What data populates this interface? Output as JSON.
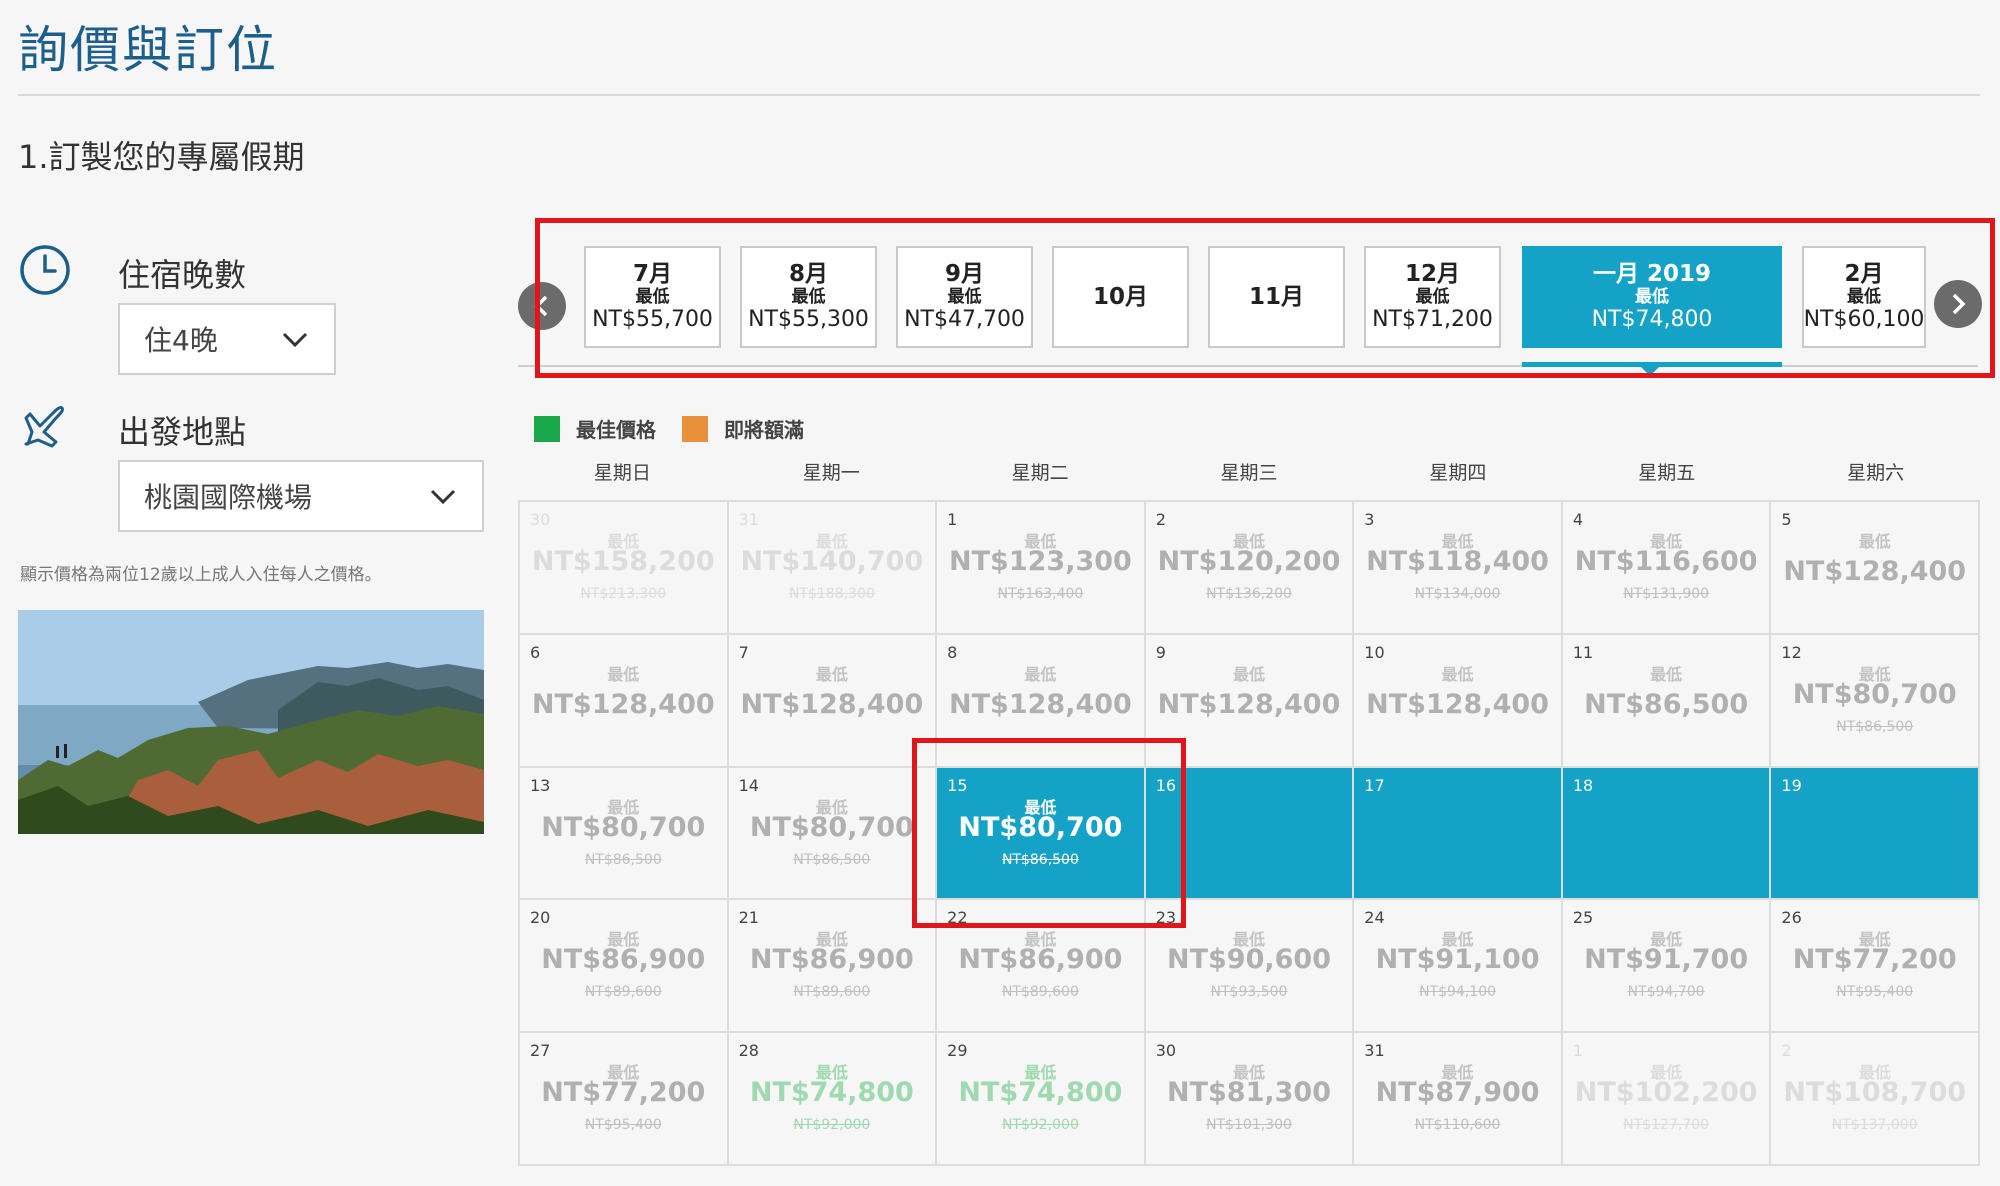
{
  "title": "詢價與訂位",
  "section_title": "1.訂製您的專屬假期",
  "stay": {
    "label": "住宿晚數",
    "value": "住4晚"
  },
  "departure": {
    "label": "出發地點",
    "value": "桃園國際機場"
  },
  "note": "顯示價格為兩位12歲以上成人入住每人之價格。",
  "months": [
    {
      "name": "7月",
      "low_label": "最低",
      "price": "NT$55,700"
    },
    {
      "name": "8月",
      "low_label": "最低",
      "price": "NT$55,300"
    },
    {
      "name": "9月",
      "low_label": "最低",
      "price": "NT$47,700"
    },
    {
      "name": "10月",
      "low_label": "",
      "price": ""
    },
    {
      "name": "11月",
      "low_label": "",
      "price": ""
    },
    {
      "name": "12月",
      "low_label": "最低",
      "price": "NT$71,200"
    },
    {
      "name": "一月 2019",
      "low_label": "最低",
      "price": "NT$74,800",
      "active": true
    },
    {
      "name": "2月",
      "low_label": "最低",
      "price": "NT$60,100"
    }
  ],
  "legend": [
    {
      "label": "最佳價格",
      "color": "#1aa84a"
    },
    {
      "label": "即將額滿",
      "color": "#e8913a"
    }
  ],
  "weekdays": [
    "星期日",
    "星期一",
    "星期二",
    "星期三",
    "星期四",
    "星期五",
    "星期六"
  ],
  "calendar": [
    {
      "day": "30",
      "low": "最低",
      "price": "NT$158,200",
      "old": "NT$213,300",
      "state": "other"
    },
    {
      "day": "31",
      "low": "最低",
      "price": "NT$140,700",
      "old": "NT$188,300",
      "state": "other"
    },
    {
      "day": "1",
      "low": "最低",
      "price": "NT$123,300",
      "old": "NT$163,400",
      "state": ""
    },
    {
      "day": "2",
      "low": "最低",
      "price": "NT$120,200",
      "old": "NT$136,200",
      "state": ""
    },
    {
      "day": "3",
      "low": "最低",
      "price": "NT$118,400",
      "old": "NT$134,000",
      "state": ""
    },
    {
      "day": "4",
      "low": "最低",
      "price": "NT$116,600",
      "old": "NT$131,900",
      "state": ""
    },
    {
      "day": "5",
      "low": "最低",
      "price": "NT$128,400",
      "old": "",
      "state": "noold"
    },
    {
      "day": "6",
      "low": "最低",
      "price": "NT$128,400",
      "old": "",
      "state": "noold"
    },
    {
      "day": "7",
      "low": "最低",
      "price": "NT$128,400",
      "old": "",
      "state": "noold"
    },
    {
      "day": "8",
      "low": "最低",
      "price": "NT$128,400",
      "old": "",
      "state": "noold"
    },
    {
      "day": "9",
      "low": "最低",
      "price": "NT$128,400",
      "old": "",
      "state": "noold"
    },
    {
      "day": "10",
      "low": "最低",
      "price": "NT$128,400",
      "old": "",
      "state": "noold"
    },
    {
      "day": "11",
      "low": "最低",
      "price": "NT$86,500",
      "old": "",
      "state": "noold"
    },
    {
      "day": "12",
      "low": "最低",
      "price": "NT$80,700",
      "old": "NT$86,500",
      "state": ""
    },
    {
      "day": "13",
      "low": "最低",
      "price": "NT$80,700",
      "old": "NT$86,500",
      "state": ""
    },
    {
      "day": "14",
      "low": "最低",
      "price": "NT$80,700",
      "old": "NT$86,500",
      "state": ""
    },
    {
      "day": "15",
      "low": "最低",
      "price": "NT$80,700",
      "old": "NT$86,500",
      "state": "sel"
    },
    {
      "day": "16",
      "low": "",
      "price": "",
      "old": "",
      "state": "sel"
    },
    {
      "day": "17",
      "low": "",
      "price": "",
      "old": "",
      "state": "sel"
    },
    {
      "day": "18",
      "low": "",
      "price": "",
      "old": "",
      "state": "sel"
    },
    {
      "day": "19",
      "low": "",
      "price": "",
      "old": "",
      "state": "sel"
    },
    {
      "day": "20",
      "low": "最低",
      "price": "NT$86,900",
      "old": "NT$89,600",
      "state": ""
    },
    {
      "day": "21",
      "low": "最低",
      "price": "NT$86,900",
      "old": "NT$89,600",
      "state": ""
    },
    {
      "day": "22",
      "low": "最低",
      "price": "NT$86,900",
      "old": "NT$89,600",
      "state": ""
    },
    {
      "day": "23",
      "low": "最低",
      "price": "NT$90,600",
      "old": "NT$93,500",
      "state": ""
    },
    {
      "day": "24",
      "low": "最低",
      "price": "NT$91,100",
      "old": "NT$94,100",
      "state": ""
    },
    {
      "day": "25",
      "low": "最低",
      "price": "NT$91,700",
      "old": "NT$94,700",
      "state": ""
    },
    {
      "day": "26",
      "low": "最低",
      "price": "NT$77,200",
      "old": "NT$95,400",
      "state": ""
    },
    {
      "day": "27",
      "low": "最低",
      "price": "NT$77,200",
      "old": "NT$95,400",
      "state": ""
    },
    {
      "day": "28",
      "low": "最低",
      "price": "NT$74,800",
      "old": "NT$92,000",
      "state": "best"
    },
    {
      "day": "29",
      "low": "最低",
      "price": "NT$74,800",
      "old": "NT$92,000",
      "state": "best"
    },
    {
      "day": "30",
      "low": "最低",
      "price": "NT$81,300",
      "old": "NT$101,300",
      "state": ""
    },
    {
      "day": "31",
      "low": "最低",
      "price": "NT$87,900",
      "old": "NT$110,600",
      "state": ""
    },
    {
      "day": "1",
      "low": "最低",
      "price": "NT$102,200",
      "old": "NT$127,700",
      "state": "other"
    },
    {
      "day": "2",
      "low": "最低",
      "price": "NT$108,700",
      "old": "NT$137,000",
      "state": "other"
    }
  ]
}
